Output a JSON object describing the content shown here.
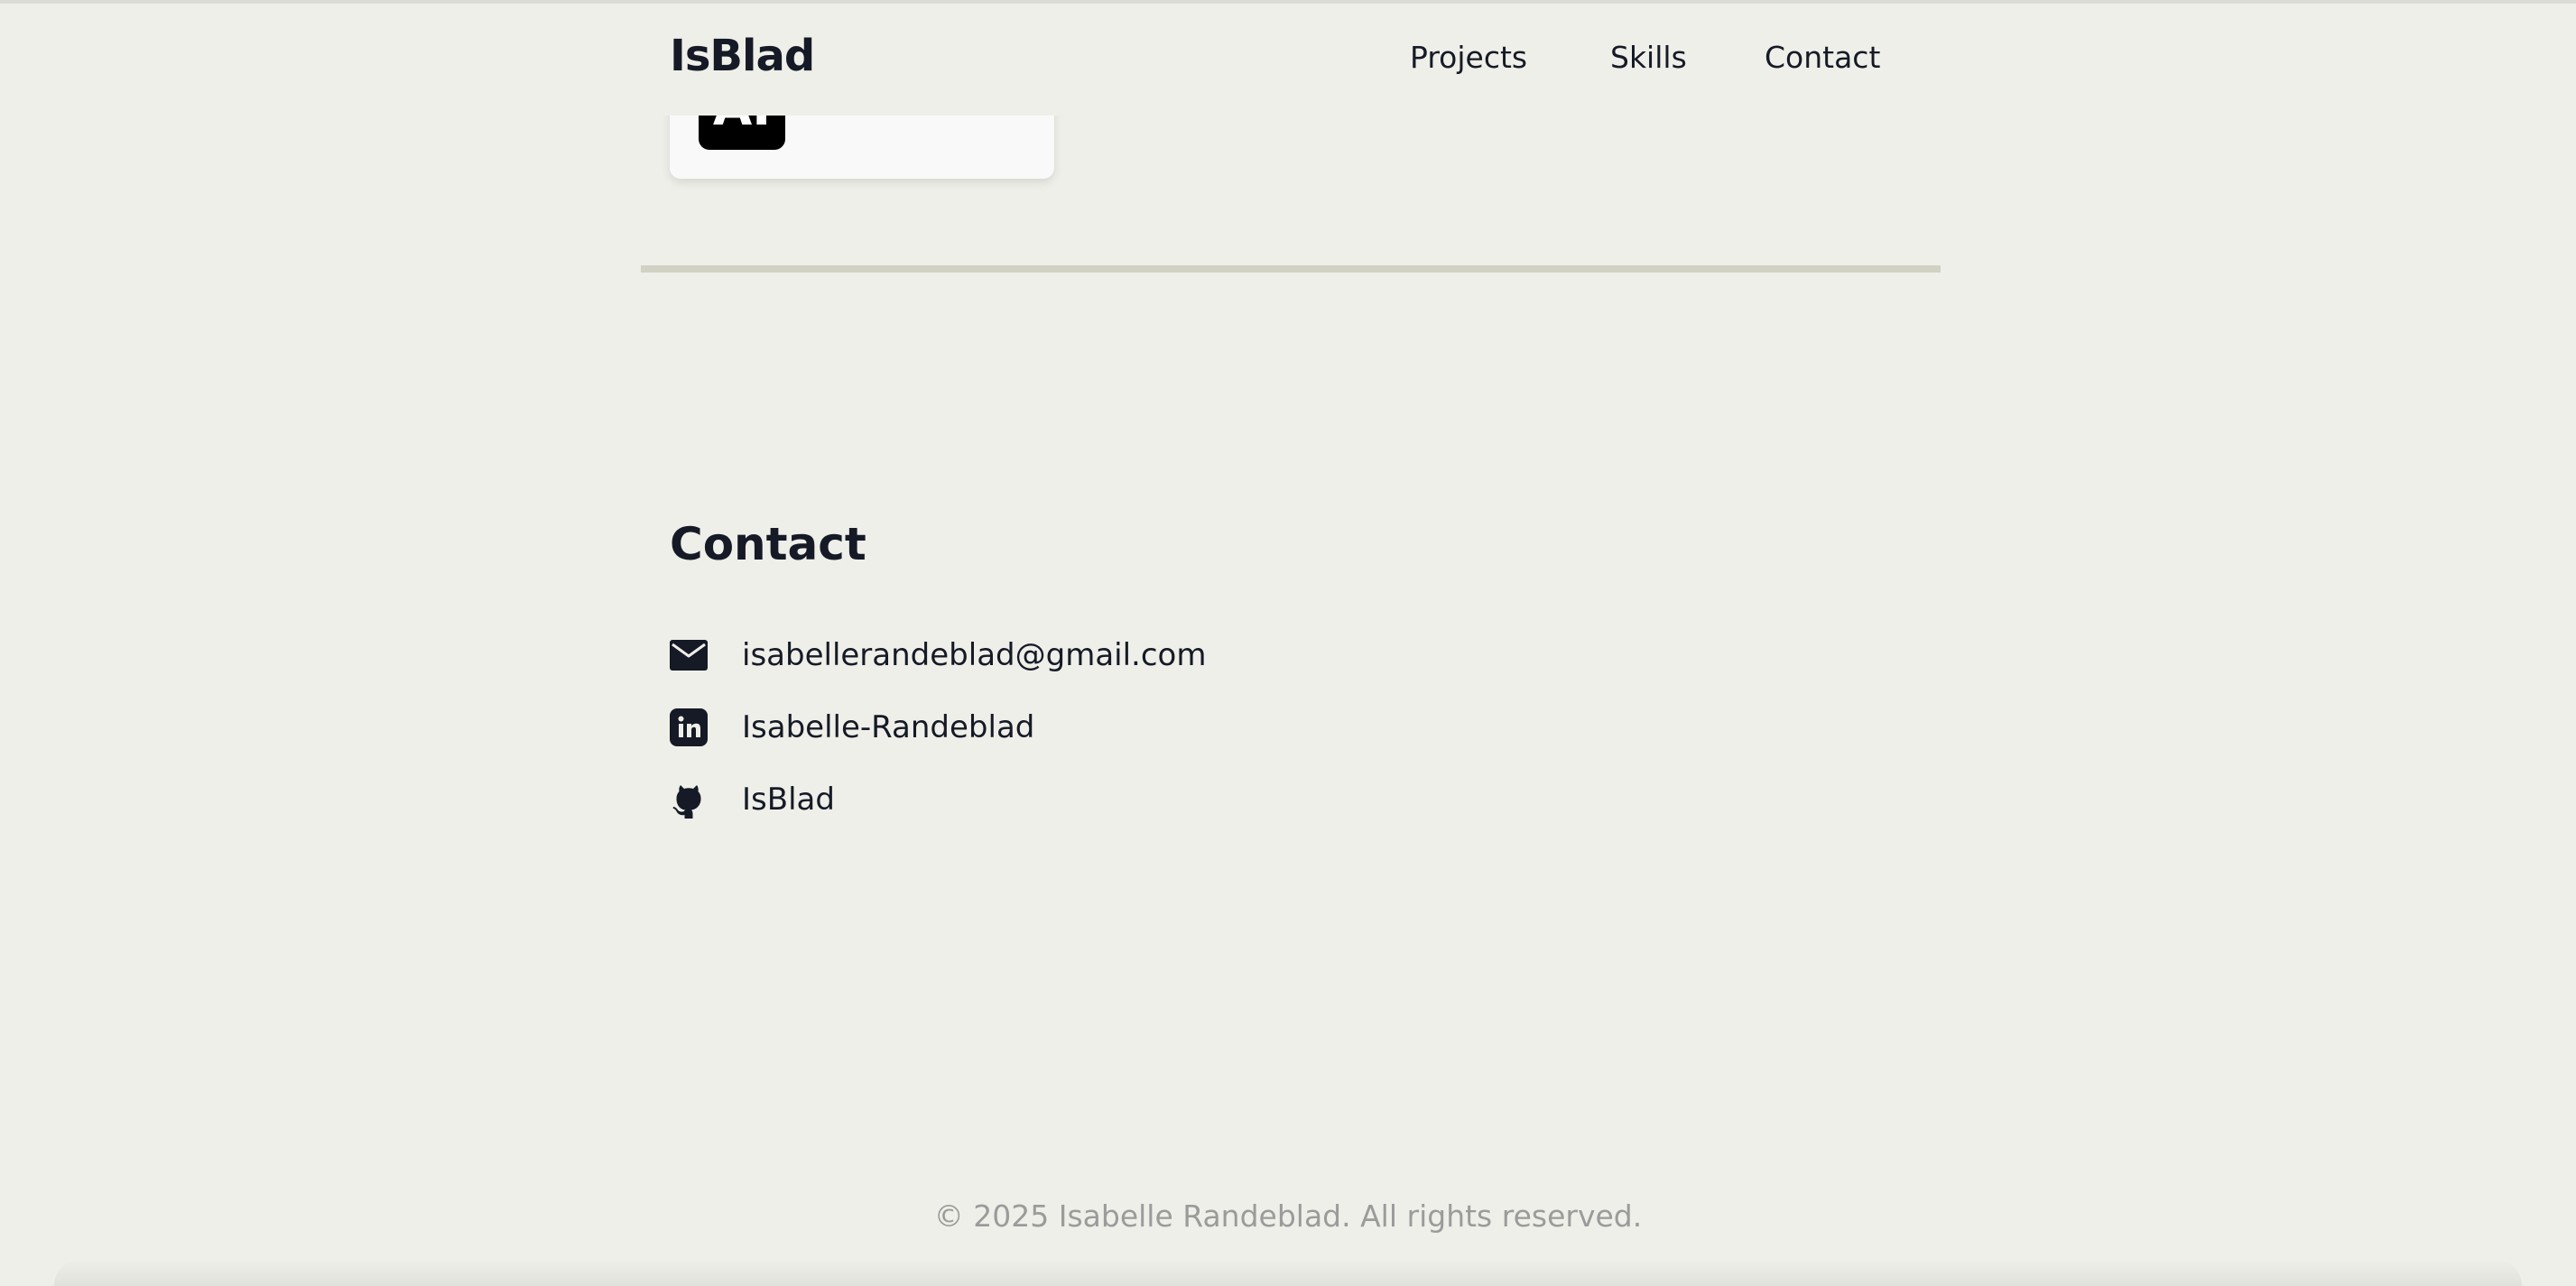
{
  "header": {
    "logo": "IsBlad",
    "nav": {
      "projects": "Projects",
      "skills": "Skills",
      "contact": "Contact"
    }
  },
  "card": {
    "icon_text": "AI"
  },
  "contact": {
    "heading": "Contact",
    "items": [
      {
        "icon": "mail-icon",
        "label": "isabellerandeblad@gmail.com"
      },
      {
        "icon": "linkedin-icon",
        "label": "Isabelle-Randeblad"
      },
      {
        "icon": "github-icon",
        "label": "IsBlad"
      }
    ]
  },
  "footer": {
    "text": "© 2025 Isabelle Randeblad. All rights reserved."
  },
  "colors": {
    "background": "#efefe9",
    "text": "#151a26",
    "divider": "#d1d2c3",
    "footer_text": "#9b9b9b"
  }
}
